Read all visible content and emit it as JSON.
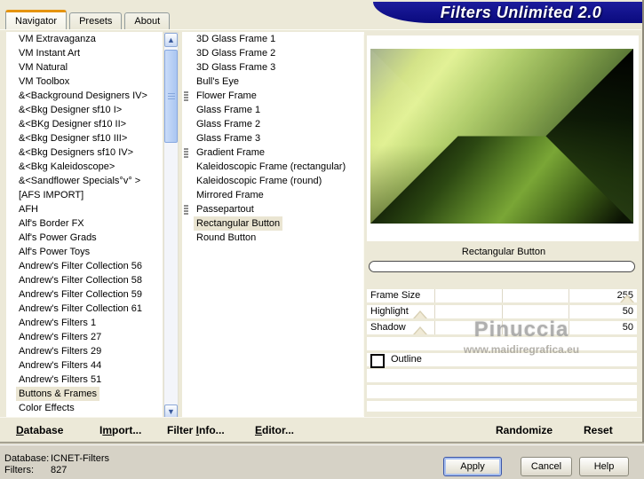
{
  "window": {
    "title": "Filters Unlimited 2.0"
  },
  "tabs": [
    {
      "label": "Navigator",
      "active": true
    },
    {
      "label": "Presets",
      "active": false
    },
    {
      "label": "About",
      "active": false
    }
  ],
  "category_list": {
    "items": [
      {
        "label": "VM Extravaganza"
      },
      {
        "label": "VM Instant Art"
      },
      {
        "label": "VM Natural"
      },
      {
        "label": "VM Toolbox"
      },
      {
        "label": "&<Background Designers IV>"
      },
      {
        "label": "&<Bkg Designer sf10 I>"
      },
      {
        "label": "&<BKg Designer sf10 II>"
      },
      {
        "label": "&<Bkg Designer sf10 III>"
      },
      {
        "label": "&<Bkg Designers sf10 IV>"
      },
      {
        "label": "&<Bkg Kaleidoscope>"
      },
      {
        "label": "&<Sandflower Specials°v° >"
      },
      {
        "label": "[AFS IMPORT]"
      },
      {
        "label": "AFH"
      },
      {
        "label": "Alf's Border FX"
      },
      {
        "label": "Alf's Power Grads"
      },
      {
        "label": "Alf's Power Toys"
      },
      {
        "label": "Andrew's Filter Collection 56"
      },
      {
        "label": "Andrew's Filter Collection 58"
      },
      {
        "label": "Andrew's Filter Collection 59"
      },
      {
        "label": "Andrew's Filter Collection 61"
      },
      {
        "label": "Andrew's Filters 1"
      },
      {
        "label": "Andrew's Filters 27"
      },
      {
        "label": "Andrew's Filters 29"
      },
      {
        "label": "Andrew's Filters 44"
      },
      {
        "label": "Andrew's Filters 51"
      },
      {
        "label": "Buttons & Frames",
        "selected": true
      },
      {
        "label": "Color Effects"
      }
    ]
  },
  "filter_list": {
    "items": [
      {
        "label": "3D Glass Frame 1"
      },
      {
        "label": "3D Glass Frame 2"
      },
      {
        "label": "3D Glass Frame 3"
      },
      {
        "label": "Bull's Eye"
      },
      {
        "label": "Flower Frame",
        "has_icon": true
      },
      {
        "label": "Glass Frame 1"
      },
      {
        "label": "Glass Frame 2"
      },
      {
        "label": "Glass Frame 3"
      },
      {
        "label": "Gradient Frame",
        "has_icon": true
      },
      {
        "label": "Kaleidoscopic Frame (rectangular)"
      },
      {
        "label": "Kaleidoscopic Frame (round)"
      },
      {
        "label": "Mirrored Frame"
      },
      {
        "label": "Passepartout",
        "has_icon": true
      },
      {
        "label": "Rectangular Button",
        "selected": true
      },
      {
        "label": "Round Button"
      }
    ]
  },
  "preview": {
    "caption": "Rectangular Button",
    "progress_value": ""
  },
  "sliders": [
    {
      "label": "Frame Size",
      "value": "255",
      "max": 255
    },
    {
      "label": "Highlight",
      "value": "50",
      "max": 255
    },
    {
      "label": "Shadow",
      "value": "50",
      "max": 255
    }
  ],
  "outline": {
    "label": "Outline",
    "checked": false
  },
  "watermark": {
    "name": "Pinuccia",
    "url": "www.maidiregrafica.eu"
  },
  "toolbar": {
    "database": {
      "pre": "",
      "key": "D",
      "post": "atabase"
    },
    "import": {
      "pre": "I",
      "key": "m",
      "post": "port..."
    },
    "filter_info": {
      "pre": "Filter ",
      "key": "I",
      "post": "nfo..."
    },
    "editor": {
      "pre": "",
      "key": "E",
      "post": "ditor..."
    },
    "randomize": "Randomize",
    "reset": "Reset"
  },
  "status": {
    "database_label": "Database:",
    "database_value": "ICNET-Filters",
    "filters_label": "Filters:",
    "filters_value": "827"
  },
  "action_buttons": {
    "apply": "Apply",
    "cancel": "Cancel",
    "help": "Help"
  },
  "colors": {
    "dialog_bg": "#ECE9D8",
    "banner_blue": "#10108E",
    "selection_bg": "#EAE5D2",
    "tab_accent_orange": "#E5940E",
    "preview_green_bright": "#DFF08B",
    "preview_green_dark": "#0C1404"
  }
}
